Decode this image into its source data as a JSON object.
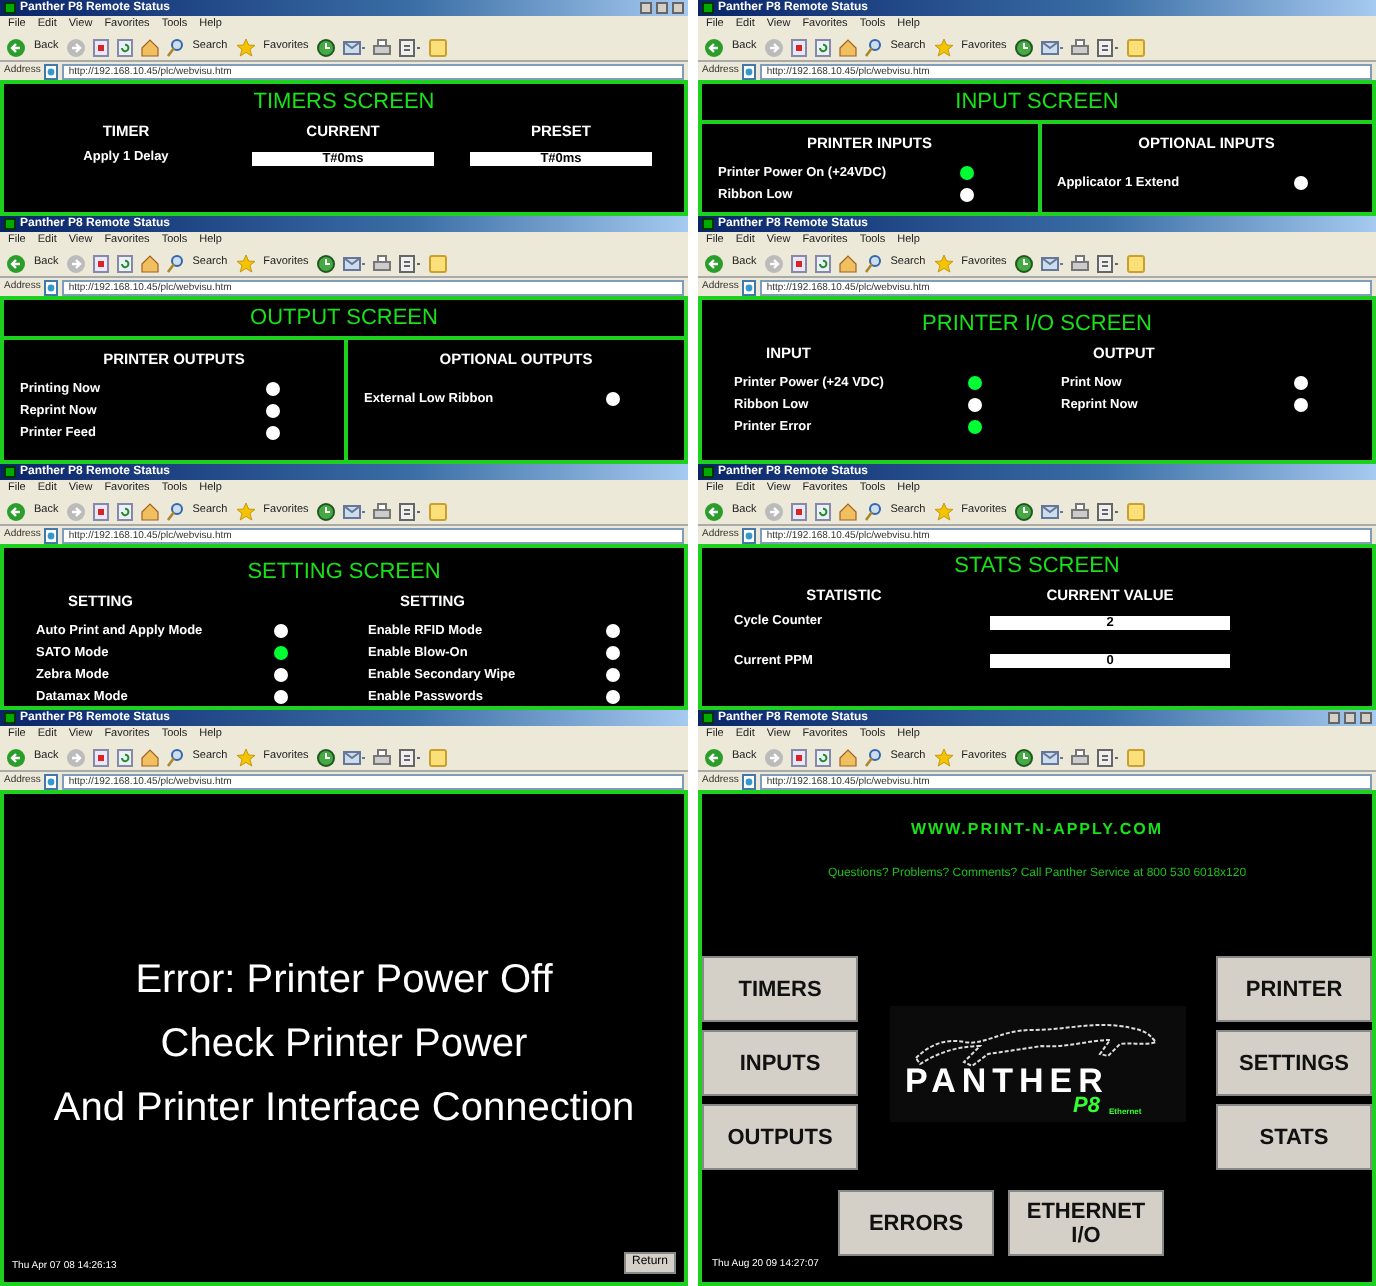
{
  "windows": [
    {
      "title": "Panther P8 Remote Status",
      "controls": true,
      "menu": [
        "File",
        "Edit",
        "View",
        "Favorites",
        "Tools",
        "Help"
      ],
      "toolbar": [
        "Back",
        "Search",
        "Favorites"
      ],
      "address_label": "Address",
      "address": "http://192.168.10.45/plc/webvisu.htm",
      "screen": {
        "kind": "table",
        "title": "TIMERS SCREEN",
        "columns": [
          "TIMER",
          "CURRENT",
          "PRESET"
        ],
        "rows": [
          {
            "label": "Apply 1 Delay",
            "values": [
              "T#0ms",
              "T#0ms"
            ]
          }
        ]
      }
    },
    {
      "title": "Panther P8 Remote Status",
      "controls": false,
      "menu": [
        "File",
        "Edit",
        "View",
        "Favorites",
        "Tools",
        "Help"
      ],
      "toolbar": [
        "Back",
        "Search",
        "Favorites"
      ],
      "address_label": "Address",
      "address": "http://192.168.10.45/plc/webvisu.htm",
      "screen": {
        "kind": "split",
        "title": "INPUT SCREEN",
        "panels": [
          {
            "heading": "PRINTER INPUTS",
            "items": [
              {
                "label": "Printer Power On (+24VDC)",
                "on": true
              },
              {
                "label": "Ribbon Low",
                "on": false
              }
            ]
          },
          {
            "heading": "OPTIONAL INPUTS",
            "items": [
              {
                "label": "Applicator 1 Extend",
                "on": false
              }
            ]
          }
        ]
      }
    },
    {
      "title": "Panther P8 Remote Status",
      "controls": false,
      "menu": [
        "File",
        "Edit",
        "View",
        "Favorites",
        "Tools",
        "Help"
      ],
      "toolbar": [
        "Back",
        "Search",
        "Favorites"
      ],
      "address_label": "Address",
      "address": "http://192.168.10.45/plc/webvisu.htm",
      "screen": {
        "kind": "split",
        "title": "OUTPUT SCREEN",
        "panels": [
          {
            "heading": "PRINTER OUTPUTS",
            "items": [
              {
                "label": "Printing Now",
                "on": false
              },
              {
                "label": "Reprint Now",
                "on": false
              },
              {
                "label": "Printer Feed",
                "on": false
              }
            ]
          },
          {
            "heading": "OPTIONAL OUTPUTS",
            "items": [
              {
                "label": "External Low Ribbon",
                "on": false
              }
            ]
          }
        ]
      }
    },
    {
      "title": "Panther P8 Remote Status",
      "controls": false,
      "menu": [
        "File",
        "Edit",
        "View",
        "Favorites",
        "Tools",
        "Help"
      ],
      "toolbar": [
        "Back",
        "Search",
        "Favorites"
      ],
      "address_label": "Address",
      "address": "http://192.168.10.45/plc/webvisu.htm",
      "screen": {
        "kind": "columns",
        "title": "PRINTER I/O SCREEN",
        "panels": [
          {
            "heading": "INPUT",
            "items": [
              {
                "label": "Printer Power (+24 VDC)",
                "on": true
              },
              {
                "label": "Ribbon Low",
                "on": false
              },
              {
                "label": "Printer Error",
                "on": true
              }
            ]
          },
          {
            "heading": "OUTPUT",
            "items": [
              {
                "label": "Print Now",
                "on": false
              },
              {
                "label": "Reprint Now",
                "on": false
              }
            ]
          }
        ]
      }
    },
    {
      "title": "Panther P8 Remote Status",
      "controls": false,
      "menu": [
        "File",
        "Edit",
        "View",
        "Favorites",
        "Tools",
        "Help"
      ],
      "toolbar": [
        "Back",
        "Search",
        "Favorites"
      ],
      "address_label": "Address",
      "address": "http://192.168.10.45/plc/webvisu.htm",
      "screen": {
        "kind": "columns",
        "title": "SETTING SCREEN",
        "panels": [
          {
            "heading": "SETTING",
            "items": [
              {
                "label": "Auto Print and Apply Mode",
                "on": false
              },
              {
                "label": "SATO Mode",
                "on": true
              },
              {
                "label": "Zebra Mode",
                "on": false
              },
              {
                "label": "Datamax Mode",
                "on": false
              }
            ]
          },
          {
            "heading": "SETTING",
            "items": [
              {
                "label": "Enable RFID Mode",
                "on": false
              },
              {
                "label": "Enable Blow-On",
                "on": false
              },
              {
                "label": "Enable Secondary Wipe",
                "on": false
              },
              {
                "label": "Enable Passwords",
                "on": false
              }
            ]
          }
        ]
      }
    },
    {
      "title": "Panther P8 Remote Status",
      "controls": false,
      "menu": [
        "File",
        "Edit",
        "View",
        "Favorites",
        "Tools",
        "Help"
      ],
      "toolbar": [
        "Back",
        "Search",
        "Favorites"
      ],
      "address_label": "Address",
      "address": "http://192.168.10.45/plc/webvisu.htm",
      "screen": {
        "kind": "table",
        "title": "STATS SCREEN",
        "columns": [
          "STATISTIC",
          "CURRENT VALUE"
        ],
        "rows": [
          {
            "label": "Cycle Counter",
            "values": [
              "2"
            ]
          },
          {
            "label": "Current PPM",
            "values": [
              "0"
            ]
          }
        ]
      }
    },
    {
      "title": "Panther P8 Remote Status",
      "controls": false,
      "menu": [
        "File",
        "Edit",
        "View",
        "Favorites",
        "Tools",
        "Help"
      ],
      "toolbar": [
        "Back",
        "Search",
        "Favorites"
      ],
      "address_label": "Address",
      "address": "http://192.168.10.45/plc/webvisu.htm",
      "screen": {
        "kind": "message",
        "lines": [
          "Error: Printer Power Off",
          "Check Printer Power",
          "And Printer Interface Connection"
        ],
        "timestamp": "Thu Apr 07 08 14:26:13",
        "button": "Return"
      }
    },
    {
      "title": "Panther P8 Remote Status",
      "controls": true,
      "menu": [
        "File",
        "Edit",
        "View",
        "Favorites",
        "Tools",
        "Help"
      ],
      "toolbar": [
        "Back",
        "Search",
        "Favorites"
      ],
      "address_label": "Address",
      "address": "http://192.168.10.45/plc/webvisu.htm",
      "screen": {
        "kind": "home",
        "site": "WWW.PRINT-N-APPLY.COM",
        "note": "Questions? Problems? Comments? Call Panther Service at 800 530 6018x120",
        "left_buttons": [
          "TIMERS",
          "INPUTS",
          "OUTPUTS"
        ],
        "right_buttons": [
          "PRINTER",
          "SETTINGS",
          "STATS"
        ],
        "bottom_buttons": [
          "ERRORS",
          "ETHERNET I/O"
        ],
        "logo": {
          "name": "PANTHER",
          "model": "P8",
          "edition": "Ethernet"
        },
        "timestamp": "Thu Aug 20 09 14:27:07"
      }
    }
  ]
}
